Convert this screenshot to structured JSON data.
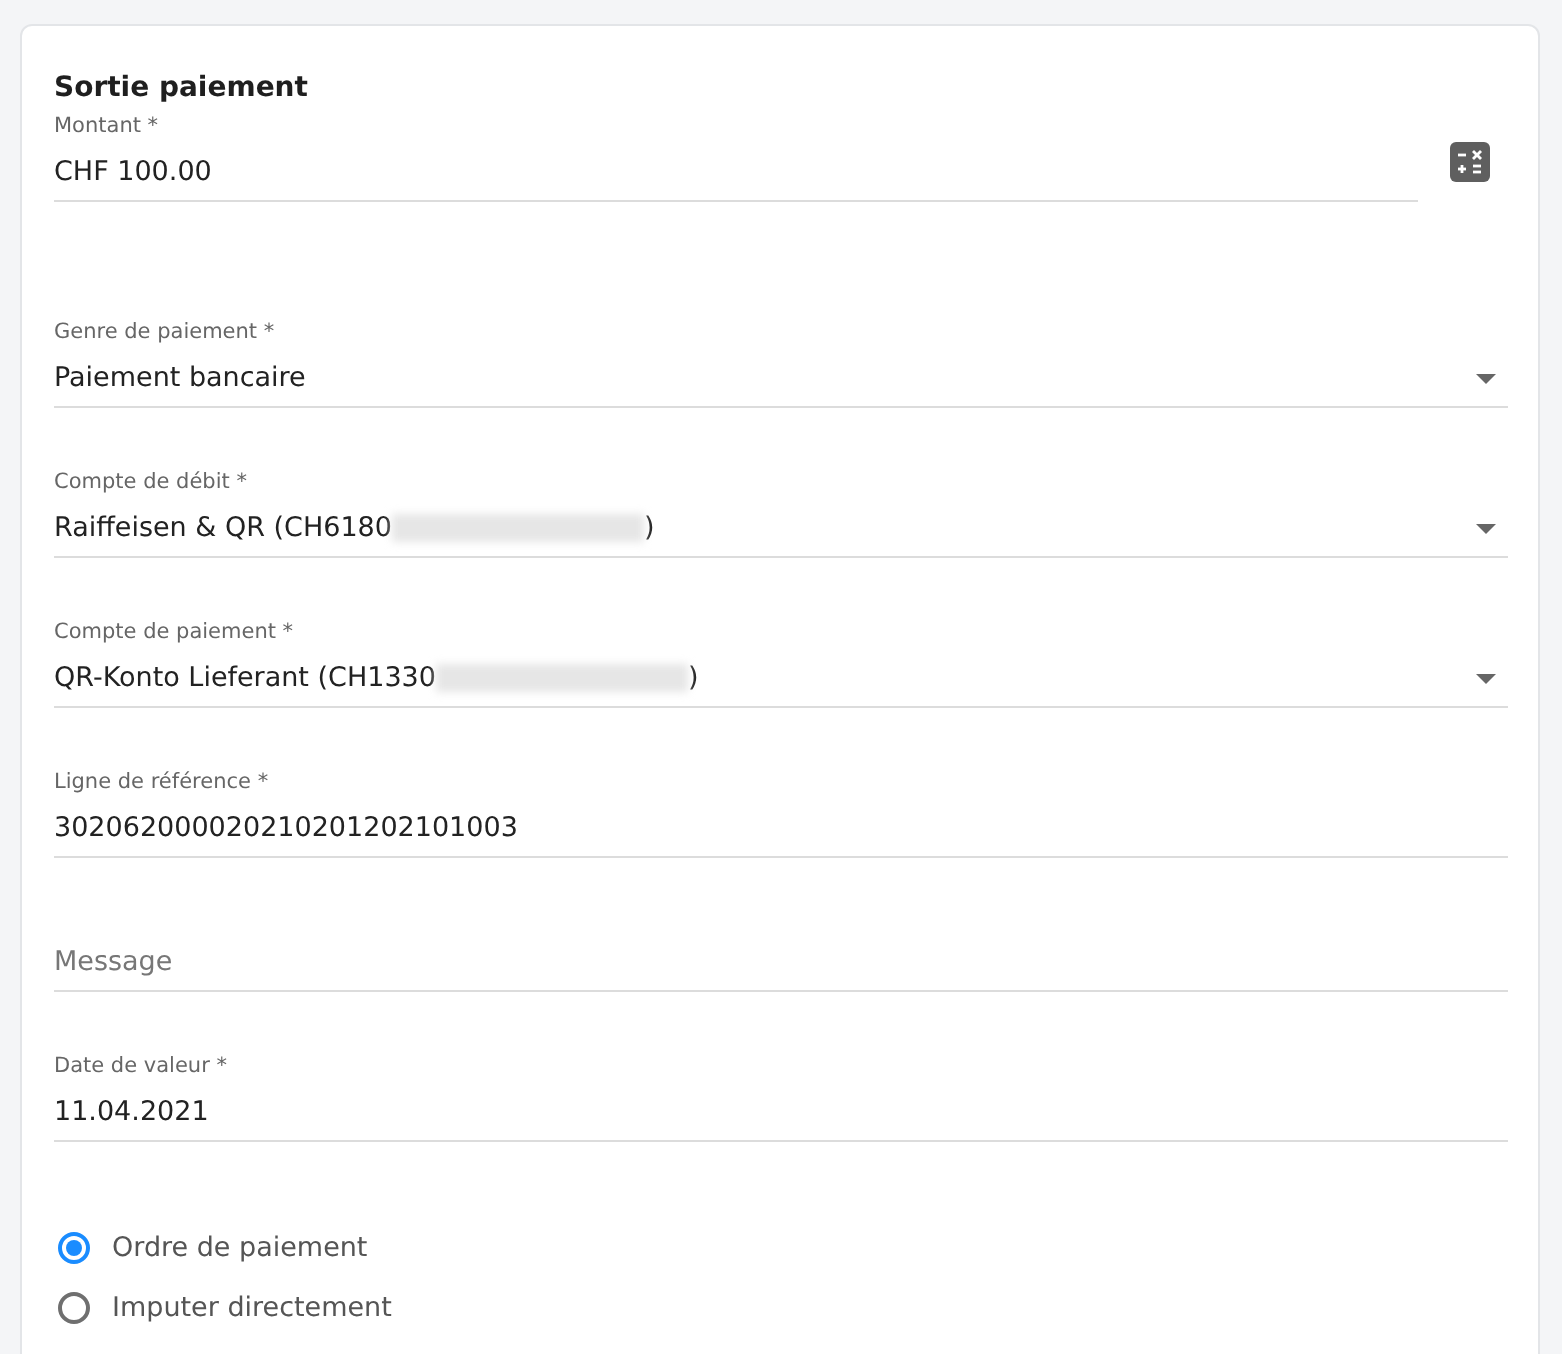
{
  "title": "Sortie paiement",
  "amount": {
    "label": "Montant *",
    "value": "CHF 100.00"
  },
  "fields": [
    {
      "kind": "select",
      "label": "Genre de paiement *",
      "value": "Paiement bancaire"
    },
    {
      "kind": "select",
      "label": "Compte de débit *",
      "value": "Raiffeisen & QR (CH6180",
      "redacted": true,
      "value_end": ")"
    },
    {
      "kind": "select",
      "label": "Compte de paiement *",
      "value": "QR-Konto Lieferant (CH1330",
      "redacted": true,
      "value_end": ")"
    },
    {
      "kind": "text",
      "label": "Ligne de référence *",
      "value": "302062000020210201202101003"
    },
    {
      "kind": "text",
      "placeholder": "Message"
    },
    {
      "kind": "text",
      "label": "Date de valeur *",
      "value": "11.04.2021"
    }
  ],
  "options": [
    {
      "label": "Ordre de paiement",
      "selected": true
    },
    {
      "label": "Imputer directement",
      "selected": false
    }
  ]
}
